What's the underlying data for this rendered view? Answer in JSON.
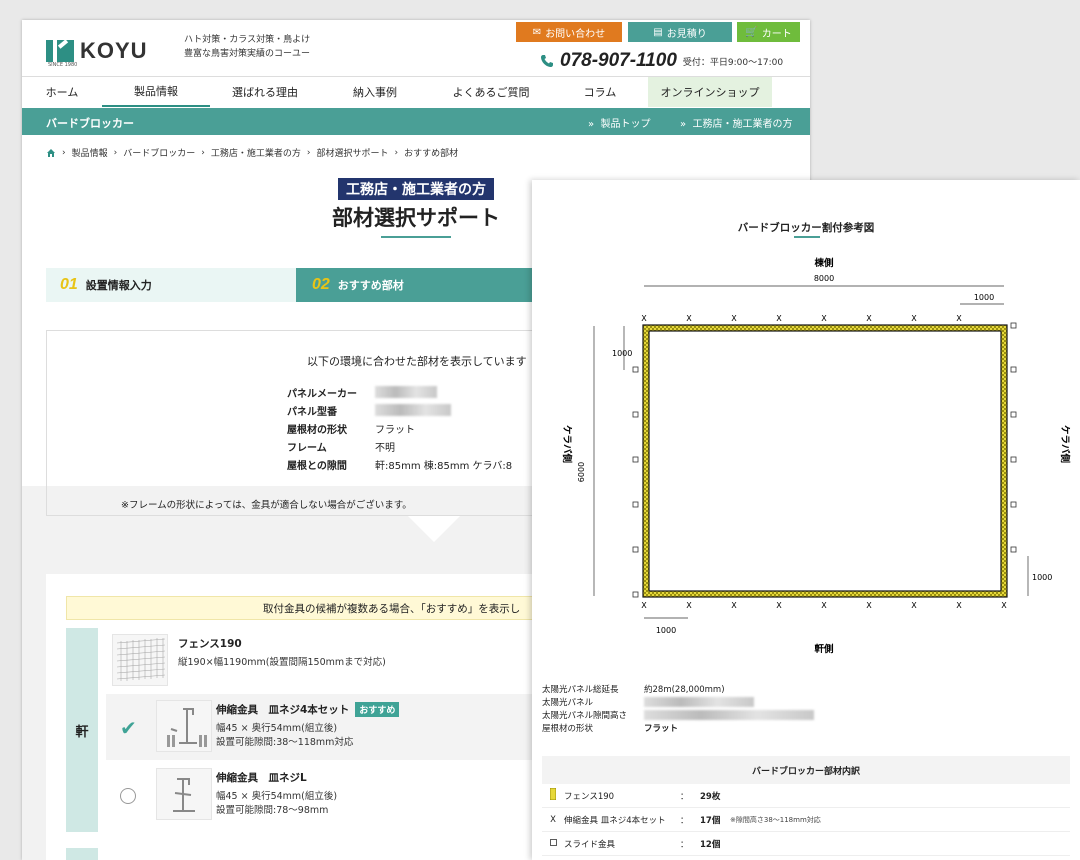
{
  "header": {
    "logo_text": "KOYU",
    "logo_since": "SINCE 1980",
    "tagline_1": "ハト対策・カラス対策・鳥よけ",
    "tagline_2": "豊富な鳥害対策実績のコーユー",
    "contact_button": "お問い合わせ",
    "estimate_button": "お見積り",
    "cart_button": "カート",
    "phone": "078-907-1100",
    "hours": "受付：平日9:00〜17:00"
  },
  "nav": [
    {
      "label": "ホーム"
    },
    {
      "label": "製品情報"
    },
    {
      "label": "選ばれる理由"
    },
    {
      "label": "納入事例"
    },
    {
      "label": "よくあるご質問"
    },
    {
      "label": "コラム"
    },
    {
      "label": "オンラインショップ"
    }
  ],
  "subbar": {
    "title": "バードブロッカー",
    "link_1": "製品トップ",
    "link_2": "工務店・施工業者の方"
  },
  "breadcrumb": [
    "製品情報",
    "バードブロッカー",
    "工務店・施工業者の方",
    "部材選択サポート",
    "おすすめ部材"
  ],
  "page": {
    "badge": "工務店・施工業者の方",
    "title": "部材選択サポート"
  },
  "steps": [
    {
      "num": "01",
      "label": "設置情報入力"
    },
    {
      "num": "02",
      "label": "おすすめ部材"
    }
  ],
  "info": {
    "lead": "以下の環境に合わせた部材を表示しています",
    "rows": [
      {
        "key": "パネルメーカー",
        "value": ""
      },
      {
        "key": "パネル型番",
        "value": ""
      },
      {
        "key": "屋根材の形状",
        "value": "フラット"
      },
      {
        "key": "フレーム",
        "value": "不明"
      },
      {
        "key": "屋根との隙間",
        "value": "軒:85mm 棟:85mm ケラバ:8"
      }
    ],
    "note": "※フレームの形状によっては、金具が適合しない場合がございます。"
  },
  "products": {
    "banner": "取付金具の候補が複数ある場合、「おすすめ」を表示し",
    "side_label": "軒",
    "items": [
      {
        "name": "フェンス190",
        "desc1": "縦190×幅1190mm(設置間隔150mmまで対応)",
        "desc2": ""
      },
      {
        "name": "伸縮金具　皿ネジ4本セット",
        "badge": "おすすめ",
        "desc1": "幅45 × 奥行54mm(組立後)",
        "desc2": "設置可能隙間:38〜118mm対応"
      },
      {
        "name": "伸縮金具　皿ネジL",
        "desc1": "幅45 × 奥行54mm(組立後)",
        "desc2": "設置可能隙間:78〜98mm"
      }
    ]
  },
  "diagram": {
    "title": "バードブロッカー割付参考図",
    "top_side": "棟側",
    "bottom_side": "軒側",
    "left_side": "ケラバ側",
    "right_side": "ケラバ側",
    "width_label": "8000",
    "height_label": "6000",
    "spacing_label": "1000"
  },
  "summary": [
    {
      "key": "太陽光パネル総延長",
      "value": "約28m(28,000mm)"
    },
    {
      "key": "太陽光パネル",
      "value": ""
    },
    {
      "key": "太陽光パネル隙間高さ",
      "value": ""
    },
    {
      "key": "屋根材の形状",
      "value": "フラット"
    }
  ],
  "parts": {
    "title": "バードブロッカー部材内訳",
    "rows": [
      {
        "name": "フェンス190",
        "colon": "：",
        "value": "29枚",
        "note": ""
      },
      {
        "name": "伸縮金具 皿ネジ4本セット",
        "colon": "：",
        "value": "17個",
        "note": "※隙間高さ38〜118mm対応"
      },
      {
        "name": "スライド金具",
        "colon": "：",
        "value": "12個",
        "note": ""
      }
    ]
  },
  "colors": {
    "teal": "#4a9f96",
    "navy": "#23356d",
    "orange": "#e07a1f",
    "green": "#6fbc3c",
    "fence_yellow": "#e6d83a"
  }
}
